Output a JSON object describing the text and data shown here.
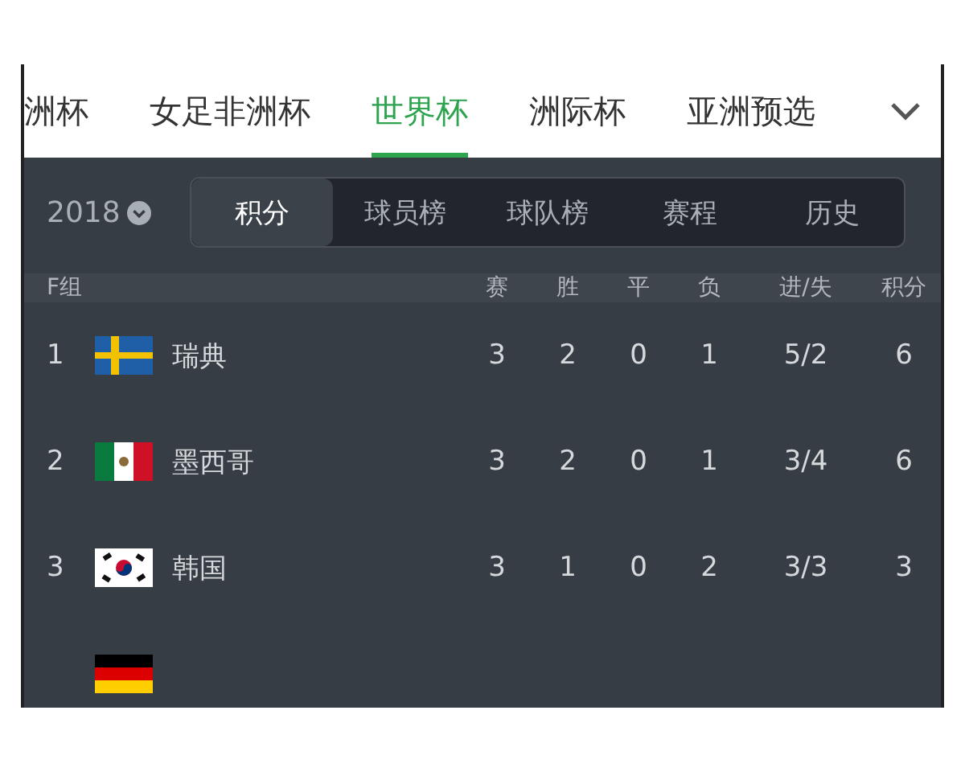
{
  "competition_tabs": [
    {
      "label": "洲杯",
      "selected": false
    },
    {
      "label": "女足非洲杯",
      "selected": false
    },
    {
      "label": "世界杯",
      "selected": true
    },
    {
      "label": "洲际杯",
      "selected": false
    },
    {
      "label": "亚洲预选",
      "selected": false
    }
  ],
  "season": "2018",
  "view_tabs": [
    {
      "label": "积分",
      "selected": true
    },
    {
      "label": "球员榜",
      "selected": false
    },
    {
      "label": "球队榜",
      "selected": false
    },
    {
      "label": "赛程",
      "selected": false
    },
    {
      "label": "历史",
      "selected": false
    }
  ],
  "table": {
    "group": "F组",
    "columns": [
      "赛",
      "胜",
      "平",
      "负",
      "进/失",
      "积分"
    ],
    "rows": [
      {
        "rank": "1",
        "kind": "sweden",
        "team": "瑞典",
        "cells": [
          "3",
          "2",
          "0",
          "1",
          "5/2",
          "6"
        ]
      },
      {
        "rank": "2",
        "kind": "mexico",
        "team": "墨西哥",
        "cells": [
          "3",
          "2",
          "0",
          "1",
          "3/4",
          "6"
        ]
      },
      {
        "rank": "3",
        "kind": "korea",
        "team": "韩国",
        "cells": [
          "3",
          "1",
          "0",
          "2",
          "3/3",
          "3"
        ]
      },
      {
        "kind": "germany"
      }
    ]
  }
}
